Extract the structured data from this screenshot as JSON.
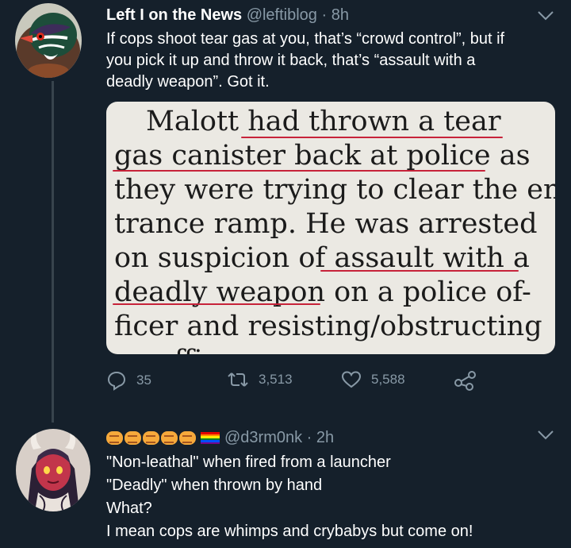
{
  "tweet1": {
    "display_name": "Left I on the News",
    "handle": "@leftiblog",
    "time": " · 8h",
    "text_lines": [
      "If cops shoot tear gas at you, that’s “crowd control”, but if",
      "you pick it up and throw it back, that’s “assault with a",
      "deadly weapon”. Got it."
    ],
    "image_text_lines": [
      "Malott had thrown a tear",
      "gas canister back at police as",
      "they were trying to clear the en-",
      "trance ramp. He was arrested",
      "on suspicion of assault with a",
      "deadly weapon on a police of-",
      "ficer and resisting/obstructing",
      "an officer"
    ],
    "stats": {
      "replies": "35",
      "retweets": "3,513",
      "likes": "5,588"
    }
  },
  "tweet2": {
    "handle": "@d3rm0nk",
    "time": " · 2h",
    "text_lines": [
      "\"Non-leathal\" when fired from a launcher",
      "\"Deadly\" when thrown by hand",
      "What?",
      "I mean cops are whimps and crybabys but come on!"
    ]
  },
  "colors": {
    "background": "#15202b",
    "secondary_text": "#8899a6",
    "highlight_underline": "#c7233a",
    "clipping_paper": "#ebe9e3"
  },
  "icons": [
    "wood-duck-avatar",
    "anime-demon-avatar",
    "chevron-down-icon",
    "reply-icon",
    "retweet-icon",
    "like-icon",
    "share-icon",
    "fist-emoji",
    "rainbow-flag-emoji"
  ]
}
